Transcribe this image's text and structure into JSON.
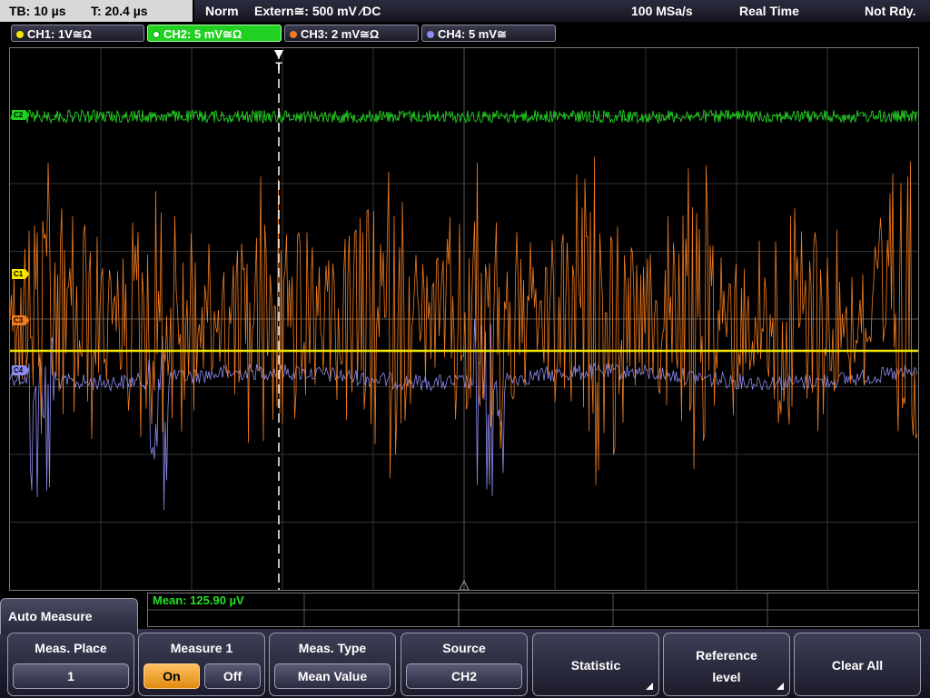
{
  "topbar": {
    "timebase": "TB: 10 µs",
    "trigger_time": "T: 20.4 µs",
    "mode": "Norm",
    "trigger_source": "Extern≅: 500 mV ⁄DC",
    "sample_rate": "100 MSa/s",
    "acquisition": "Real Time",
    "state": "Not Rdy."
  },
  "channels": [
    {
      "label": "CH1: 1V≅Ω",
      "color": "#f2e600",
      "marker": "C1"
    },
    {
      "label": "CH2: 5 mV≅Ω",
      "color": "#22d022",
      "marker": "C2",
      "active": true
    },
    {
      "label": "CH3: 2 mV≅Ω",
      "color": "#f07c20",
      "marker": "C3"
    },
    {
      "label": "CH4: 5 mV≅",
      "color": "#8c8cf0",
      "marker": "C4"
    }
  ],
  "plot": {
    "trigger_marker": "T",
    "grid_columns": 10,
    "grid_rows": 8
  },
  "measurement": {
    "result": "Mean: 125.90 µV"
  },
  "menu": {
    "title": "Auto Measure",
    "softkeys": {
      "meas_place": {
        "label": "Meas. Place",
        "value": "1"
      },
      "measure": {
        "label": "Measure 1",
        "on": "On",
        "off": "Off",
        "state": "On"
      },
      "meas_type": {
        "label": "Meas. Type",
        "value": "Mean Value"
      },
      "source": {
        "label": "Source",
        "value": "CH2"
      },
      "statistic": {
        "label": "Statistic"
      },
      "reference": {
        "label_line1": "Reference",
        "label_line2": "level"
      },
      "clear_all": {
        "label": "Clear All"
      }
    }
  }
}
